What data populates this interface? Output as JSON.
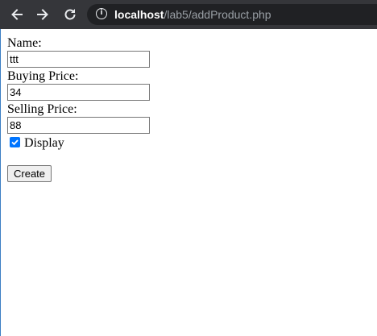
{
  "browser": {
    "url_host": "localhost",
    "url_path": "/lab5/addProduct.php",
    "icons": [
      "back-icon",
      "forward-icon",
      "reload-icon",
      "info-icon"
    ]
  },
  "form": {
    "name_label": "Name:",
    "name_value": "ttt",
    "buying_label": "Buying Price:",
    "buying_value": "34",
    "selling_label": "Selling Price:",
    "selling_value": "88",
    "display_label": "Display",
    "display_checked": true,
    "create_label": "Create"
  },
  "colors": {
    "toolbar": "#35363a",
    "omnibox": "#202124",
    "checkbox": "#0075ff"
  }
}
